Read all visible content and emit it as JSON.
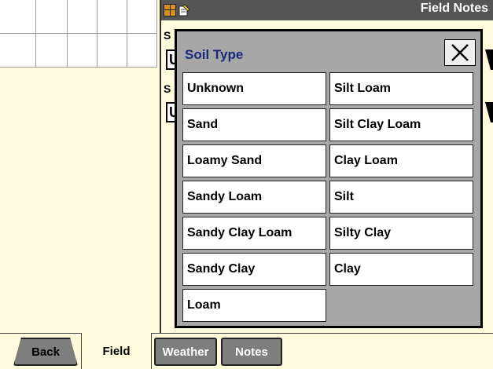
{
  "window": {
    "title": "Field Notes",
    "icons": [
      "grid-map-icon",
      "notes-pencil-icon"
    ]
  },
  "panel": {
    "label_1": "S",
    "field_1_value": "U",
    "label_2": "S",
    "field_2_value": "U"
  },
  "modal": {
    "title": "Soil Type",
    "close_icon": "close-icon",
    "options": [
      "Unknown",
      "Silt Loam",
      "Sand",
      "Silt Clay Loam",
      "Loamy Sand",
      "Clay Loam",
      "Sandy Loam",
      "Silt",
      "Sandy Clay Loam",
      "Silty Clay",
      "Sandy Clay",
      "Clay",
      "Loam"
    ]
  },
  "tabs": {
    "back": "Back",
    "field": "Field",
    "weather": "Weather",
    "notes": "Notes"
  },
  "colors": {
    "background": "#fffbdc",
    "modal_bg": "#a7a7a7",
    "title_bar": "#555555",
    "modal_title": "#1a2a7a",
    "tab_inactive": "#7e7e7e"
  }
}
